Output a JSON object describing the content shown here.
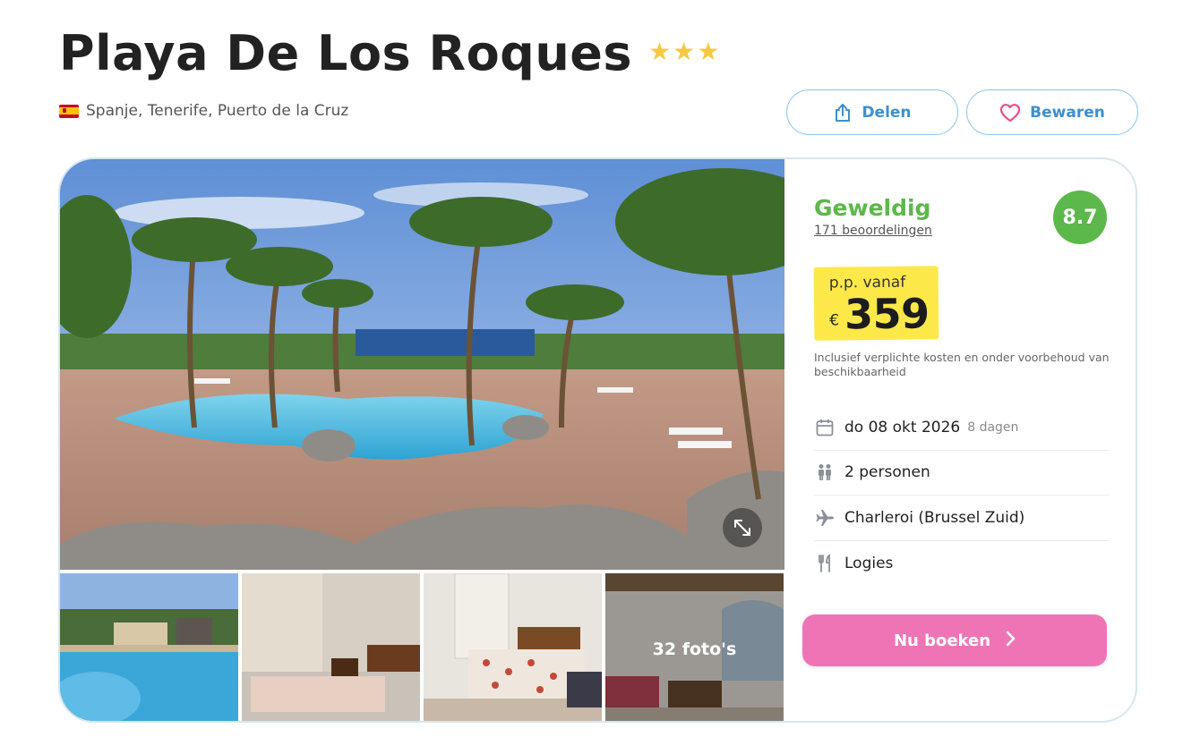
{
  "hotel": {
    "name": "Playa De Los Roques",
    "stars": 3,
    "location": "Spanje, Tenerife, Puerto de la Cruz"
  },
  "actions": {
    "share_label": "Delen",
    "save_label": "Bewaren"
  },
  "gallery": {
    "photo_count_label": "32 foto's"
  },
  "rating": {
    "word": "Geweldig",
    "reviews_label": "171 beoordelingen",
    "score": "8.7"
  },
  "price": {
    "prefix": "p.p. vanaf",
    "currency": "€",
    "amount": "359",
    "note": "Inclusief verplichte kosten en onder voorbehoud van beschikbaarheid"
  },
  "details": {
    "date": "do 08 okt 2026",
    "duration": "8 dagen",
    "persons": "2 personen",
    "departure": "Charleroi (Brussel Zuid)",
    "board": "Logies"
  },
  "book_button": {
    "label": "Nu boeken"
  },
  "colors": {
    "accent_blue": "#3f8fcd",
    "rating_green": "#5cb84a",
    "price_yellow": "#fde84a",
    "book_pink": "#ef74b6",
    "heart_pink": "#e84b8a",
    "stars_gold": "#f6c844"
  },
  "icons": {
    "share": "share-icon",
    "save": "heart-icon",
    "expand": "expand-icon",
    "date": "calendar-icon",
    "persons": "people-icon",
    "departure": "plane-icon",
    "board": "cutlery-icon",
    "book": "chevron-right-icon"
  }
}
